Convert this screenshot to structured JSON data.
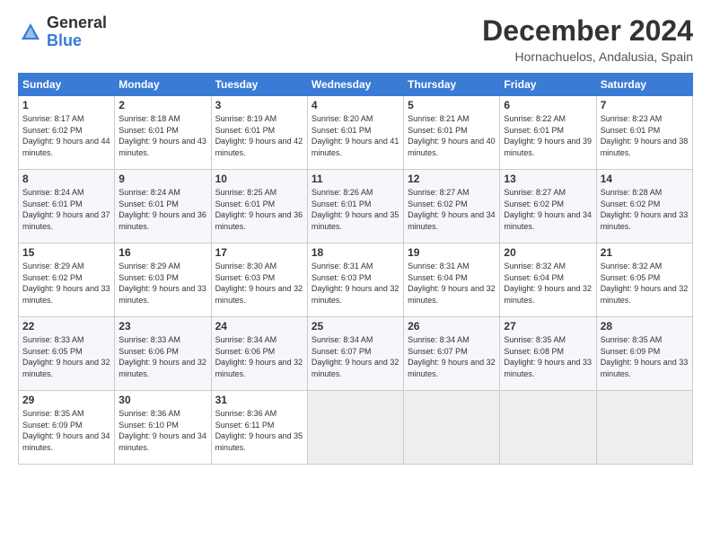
{
  "header": {
    "logo_general": "General",
    "logo_blue": "Blue",
    "month_title": "December 2024",
    "location": "Hornachuelos, Andalusia, Spain"
  },
  "days_of_week": [
    "Sunday",
    "Monday",
    "Tuesday",
    "Wednesday",
    "Thursday",
    "Friday",
    "Saturday"
  ],
  "weeks": [
    [
      {
        "day": "1",
        "sunrise": "8:17 AM",
        "sunset": "6:02 PM",
        "daylight": "9 hours and 44 minutes."
      },
      {
        "day": "2",
        "sunrise": "8:18 AM",
        "sunset": "6:01 PM",
        "daylight": "9 hours and 43 minutes."
      },
      {
        "day": "3",
        "sunrise": "8:19 AM",
        "sunset": "6:01 PM",
        "daylight": "9 hours and 42 minutes."
      },
      {
        "day": "4",
        "sunrise": "8:20 AM",
        "sunset": "6:01 PM",
        "daylight": "9 hours and 41 minutes."
      },
      {
        "day": "5",
        "sunrise": "8:21 AM",
        "sunset": "6:01 PM",
        "daylight": "9 hours and 40 minutes."
      },
      {
        "day": "6",
        "sunrise": "8:22 AM",
        "sunset": "6:01 PM",
        "daylight": "9 hours and 39 minutes."
      },
      {
        "day": "7",
        "sunrise": "8:23 AM",
        "sunset": "6:01 PM",
        "daylight": "9 hours and 38 minutes."
      }
    ],
    [
      {
        "day": "8",
        "sunrise": "8:24 AM",
        "sunset": "6:01 PM",
        "daylight": "9 hours and 37 minutes."
      },
      {
        "day": "9",
        "sunrise": "8:24 AM",
        "sunset": "6:01 PM",
        "daylight": "9 hours and 36 minutes."
      },
      {
        "day": "10",
        "sunrise": "8:25 AM",
        "sunset": "6:01 PM",
        "daylight": "9 hours and 36 minutes."
      },
      {
        "day": "11",
        "sunrise": "8:26 AM",
        "sunset": "6:01 PM",
        "daylight": "9 hours and 35 minutes."
      },
      {
        "day": "12",
        "sunrise": "8:27 AM",
        "sunset": "6:02 PM",
        "daylight": "9 hours and 34 minutes."
      },
      {
        "day": "13",
        "sunrise": "8:27 AM",
        "sunset": "6:02 PM",
        "daylight": "9 hours and 34 minutes."
      },
      {
        "day": "14",
        "sunrise": "8:28 AM",
        "sunset": "6:02 PM",
        "daylight": "9 hours and 33 minutes."
      }
    ],
    [
      {
        "day": "15",
        "sunrise": "8:29 AM",
        "sunset": "6:02 PM",
        "daylight": "9 hours and 33 minutes."
      },
      {
        "day": "16",
        "sunrise": "8:29 AM",
        "sunset": "6:03 PM",
        "daylight": "9 hours and 33 minutes."
      },
      {
        "day": "17",
        "sunrise": "8:30 AM",
        "sunset": "6:03 PM",
        "daylight": "9 hours and 32 minutes."
      },
      {
        "day": "18",
        "sunrise": "8:31 AM",
        "sunset": "6:03 PM",
        "daylight": "9 hours and 32 minutes."
      },
      {
        "day": "19",
        "sunrise": "8:31 AM",
        "sunset": "6:04 PM",
        "daylight": "9 hours and 32 minutes."
      },
      {
        "day": "20",
        "sunrise": "8:32 AM",
        "sunset": "6:04 PM",
        "daylight": "9 hours and 32 minutes."
      },
      {
        "day": "21",
        "sunrise": "8:32 AM",
        "sunset": "6:05 PM",
        "daylight": "9 hours and 32 minutes."
      }
    ],
    [
      {
        "day": "22",
        "sunrise": "8:33 AM",
        "sunset": "6:05 PM",
        "daylight": "9 hours and 32 minutes."
      },
      {
        "day": "23",
        "sunrise": "8:33 AM",
        "sunset": "6:06 PM",
        "daylight": "9 hours and 32 minutes."
      },
      {
        "day": "24",
        "sunrise": "8:34 AM",
        "sunset": "6:06 PM",
        "daylight": "9 hours and 32 minutes."
      },
      {
        "day": "25",
        "sunrise": "8:34 AM",
        "sunset": "6:07 PM",
        "daylight": "9 hours and 32 minutes."
      },
      {
        "day": "26",
        "sunrise": "8:34 AM",
        "sunset": "6:07 PM",
        "daylight": "9 hours and 32 minutes."
      },
      {
        "day": "27",
        "sunrise": "8:35 AM",
        "sunset": "6:08 PM",
        "daylight": "9 hours and 33 minutes."
      },
      {
        "day": "28",
        "sunrise": "8:35 AM",
        "sunset": "6:09 PM",
        "daylight": "9 hours and 33 minutes."
      }
    ],
    [
      {
        "day": "29",
        "sunrise": "8:35 AM",
        "sunset": "6:09 PM",
        "daylight": "9 hours and 34 minutes."
      },
      {
        "day": "30",
        "sunrise": "8:36 AM",
        "sunset": "6:10 PM",
        "daylight": "9 hours and 34 minutes."
      },
      {
        "day": "31",
        "sunrise": "8:36 AM",
        "sunset": "6:11 PM",
        "daylight": "9 hours and 35 minutes."
      },
      null,
      null,
      null,
      null
    ]
  ]
}
